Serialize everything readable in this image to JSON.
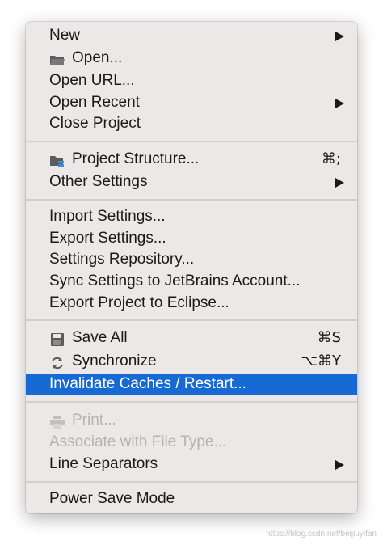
{
  "menu": {
    "items": [
      {
        "label": "New"
      },
      {
        "label": "Open...",
        "icon": "folder-icon"
      },
      {
        "label": "Open URL..."
      },
      {
        "label": "Open Recent"
      },
      {
        "label": "Close Project"
      },
      {
        "label": "Project Structure...",
        "icon": "project-structure-icon",
        "shortcut": "⌘;"
      },
      {
        "label": "Other Settings"
      },
      {
        "label": "Import Settings..."
      },
      {
        "label": "Export Settings..."
      },
      {
        "label": "Settings Repository..."
      },
      {
        "label": "Sync Settings to JetBrains Account..."
      },
      {
        "label": "Export Project to Eclipse..."
      },
      {
        "label": "Save All",
        "icon": "save-icon",
        "shortcut": "⌘S"
      },
      {
        "label": "Synchronize",
        "icon": "sync-icon",
        "shortcut": "⌥⌘Y"
      },
      {
        "label": "Invalidate Caches / Restart...",
        "state": "selected"
      },
      {
        "label": "Print...",
        "icon": "printer-icon",
        "state": "disabled"
      },
      {
        "label": "Associate with File Type...",
        "state": "disabled"
      },
      {
        "label": "Line Separators"
      },
      {
        "label": "Power Save Mode"
      }
    ]
  },
  "colors": {
    "menu_background": "#ede8e8",
    "selection": "#1769d4",
    "text": "#1a1a1a",
    "disabled_text": "#b8b3b3",
    "separator": "#d4cfcf"
  },
  "watermark": "https://blog.csdn.net/beijiuyifan"
}
